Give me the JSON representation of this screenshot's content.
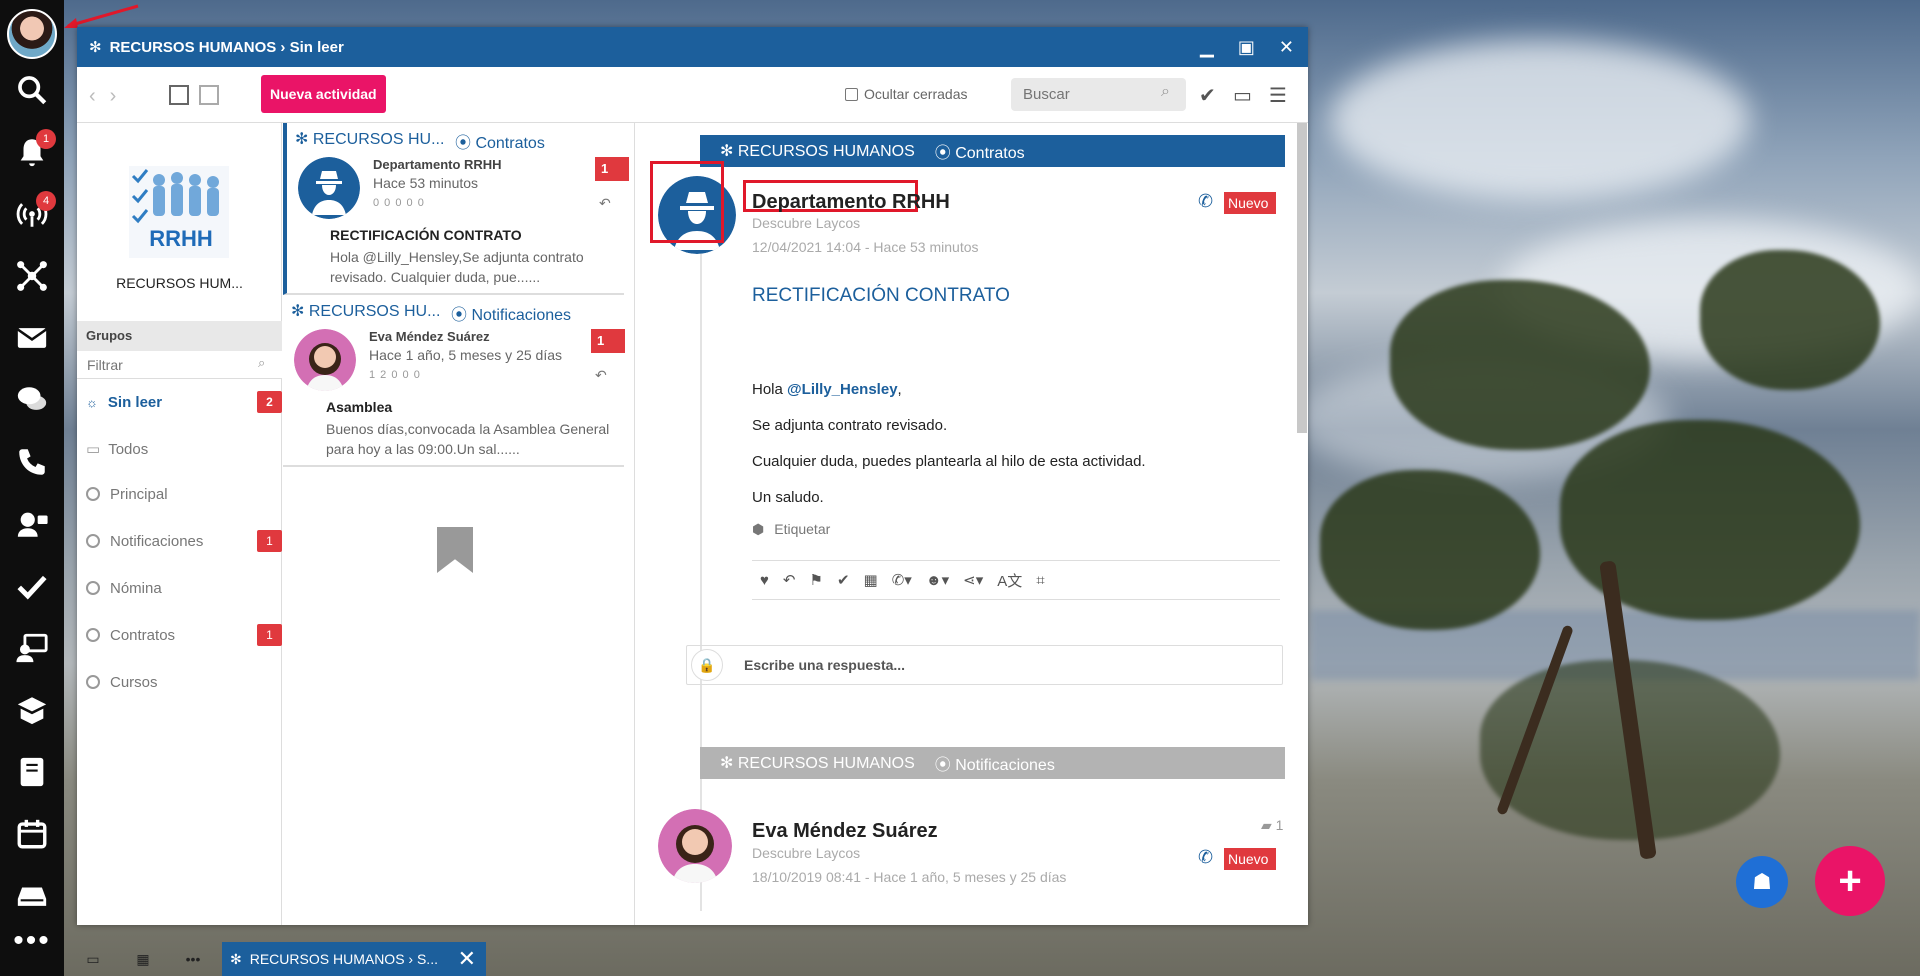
{
  "window": {
    "title": "RECURSOS HUMANOS › Sin leer",
    "controls": [
      "minimize",
      "maximize",
      "close"
    ]
  },
  "dock": {
    "notification_badges": {
      "notifications": "1",
      "broadcast": "4"
    },
    "more": "•••"
  },
  "toolbar": {
    "new_activity": "Nueva actividad",
    "hide_closed": "Ocultar cerradas",
    "search_placeholder": "Buscar"
  },
  "groups_panel": {
    "group_name": "RECURSOS HUM...",
    "logo_text": "RRHH",
    "header": "Grupos",
    "filter_placeholder": "Filtrar",
    "items": [
      {
        "label": "Sin leer",
        "count": "2"
      },
      {
        "label": "Todos",
        "count": ""
      },
      {
        "label": "Principal",
        "count": ""
      },
      {
        "label": "Notificaciones",
        "count": "1"
      },
      {
        "label": "Nómina",
        "count": ""
      },
      {
        "label": "Contratos",
        "count": "1"
      },
      {
        "label": "Cursos",
        "count": ""
      }
    ]
  },
  "activity_list": [
    {
      "group": "RECURSOS HU...",
      "channel": "Contratos",
      "author": "Departamento RRHH",
      "time": "Hace 53 minutos",
      "stats": "0  0  0  0  0",
      "badge": "1",
      "subject": "RECTIFICACIÓN CONTRATO",
      "preview": "Hola @Lilly_Hensley,Se adjunta contrato revisado. Cualquier duda, pue......"
    },
    {
      "group": "RECURSOS HU...",
      "channel": "Notificaciones",
      "author": "Eva Méndez Suárez",
      "time": "Hace 1 año, 5 meses y 25 días",
      "stats": "1  2  0  0  0",
      "badge": "1",
      "subject": "Asamblea",
      "preview": "Buenos días,convocada la Asamblea General para hoy a las 09:00.Un sal......"
    }
  ],
  "detail": {
    "bar1": {
      "group": "RECURSOS HUMANOS",
      "channel": "Contratos"
    },
    "author": "Departamento RRHH",
    "subtitle": "Descubre Laycos",
    "date": "12/04/2021 14:04 - Hace 53 minutos",
    "status": "Nuevo",
    "title": "RECTIFICACIÓN CONTRATO",
    "greeting": "Hola",
    "mention": "@Lilly_Hensley",
    "comma": ",",
    "body2": "Se adjunta contrato revisado.",
    "body3": "Cualquier duda, puedes plantearla al hilo de esta actividad.",
    "body4": "Un saludo.",
    "tag_label": "Etiquetar",
    "reply_placeholder": "Escribe una respuesta...",
    "bar2": {
      "group": "RECURSOS HUMANOS",
      "channel": "Notificaciones"
    },
    "author2": "Eva Méndez Suárez",
    "subtitle2": "Descubre Laycos",
    "date2": "18/10/2019 08:41 - Hace 1 año, 5 meses y 25 días",
    "status2": "Nuevo",
    "comment_count": "1"
  },
  "taskbar": {
    "tab": "RECURSOS HUMANOS › S..."
  },
  "colors": {
    "primary": "#1c5f9c",
    "accent": "#ea1467",
    "badge": "#e0393e"
  }
}
